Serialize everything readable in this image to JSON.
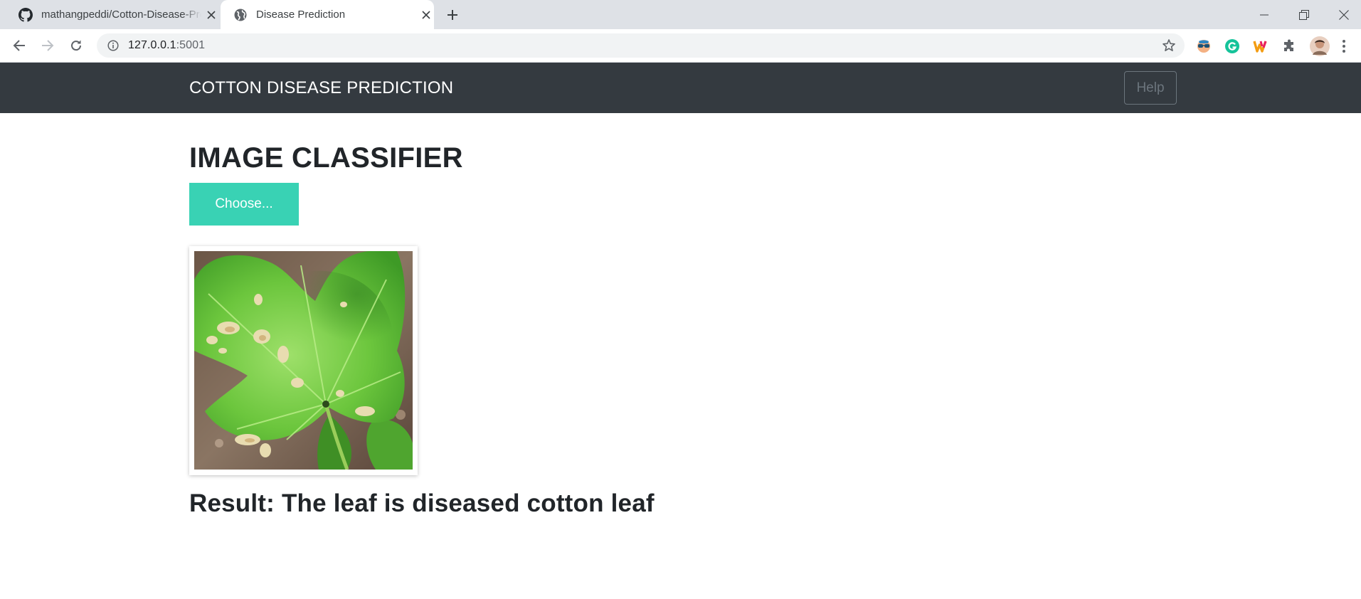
{
  "browser": {
    "tabs": [
      {
        "title": "mathangpeddi/Cotton-Disease-Prediction",
        "favicon": "github-icon",
        "active": false
      },
      {
        "title": "Disease Prediction",
        "favicon": "globe-icon",
        "active": true
      }
    ],
    "address": {
      "host": "127.0.0.1",
      "port": ":5001"
    }
  },
  "page": {
    "brand": "COTTON DISEASE PREDICTION",
    "help_label": "Help",
    "heading": "IMAGE CLASSIFIER",
    "choose_label": "Choose...",
    "result_text": "Result: The leaf is diseased cotton leaf"
  },
  "colors": {
    "navbar_bg": "#343a40",
    "choose_button": "#39d2b4",
    "tabstrip_bg": "#dee1e6"
  }
}
